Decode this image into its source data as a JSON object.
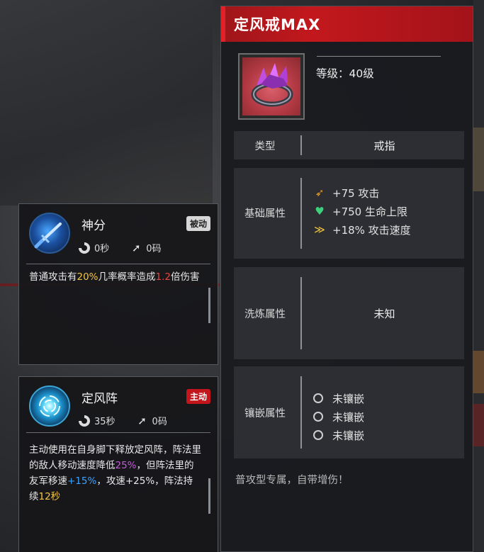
{
  "skills": [
    {
      "name": "神分",
      "tag": "被动",
      "cooldown": "0秒",
      "range": "0码",
      "desc": [
        {
          "text": "普通攻击有",
          "hl": ""
        },
        {
          "text": "20%",
          "hl": "yellow"
        },
        {
          "text": "几率概率造成",
          "hl": ""
        },
        {
          "text": "1.2",
          "hl": "red"
        },
        {
          "text": "倍伤害",
          "hl": ""
        }
      ]
    },
    {
      "name": "定风阵",
      "tag": "主动",
      "cooldown": "35秒",
      "range": "0码",
      "desc": [
        {
          "text": "主动使用在自身脚下释放定风阵，阵法里的敌人移动速度降低",
          "hl": ""
        },
        {
          "text": "25%",
          "hl": "purple"
        },
        {
          "text": "，但阵法里的友军移速",
          "hl": ""
        },
        {
          "text": "+15%",
          "hl": "blue"
        },
        {
          "text": "，攻速+25%，阵法持续",
          "hl": ""
        },
        {
          "text": "12秒",
          "hl": "yellow"
        }
      ]
    }
  ],
  "item": {
    "title": "定风戒MAX",
    "level": "等级：40级",
    "type_label": "类型",
    "type_value": "戒指",
    "base_label": "基础属性",
    "base_attrs": [
      {
        "icon": "attack-icon",
        "text": "+75 攻击"
      },
      {
        "icon": "heart-icon",
        "text": "+750 生命上限"
      },
      {
        "icon": "attack-speed-icon",
        "text": "+18% 攻击速度"
      }
    ],
    "refine_label": "洗炼属性",
    "refine_value": "未知",
    "socket_label": "镶嵌属性",
    "sockets": [
      "未镶嵌",
      "未镶嵌",
      "未镶嵌"
    ],
    "footer": "普攻型专属，自带增伤！"
  },
  "colors": {
    "header_red": "#c2181d",
    "highlight_yellow": "#f5c542",
    "highlight_red": "#e04848",
    "highlight_purple": "#c45ad8",
    "highlight_blue": "#3da2ff",
    "tag_active": "#c2161c"
  }
}
